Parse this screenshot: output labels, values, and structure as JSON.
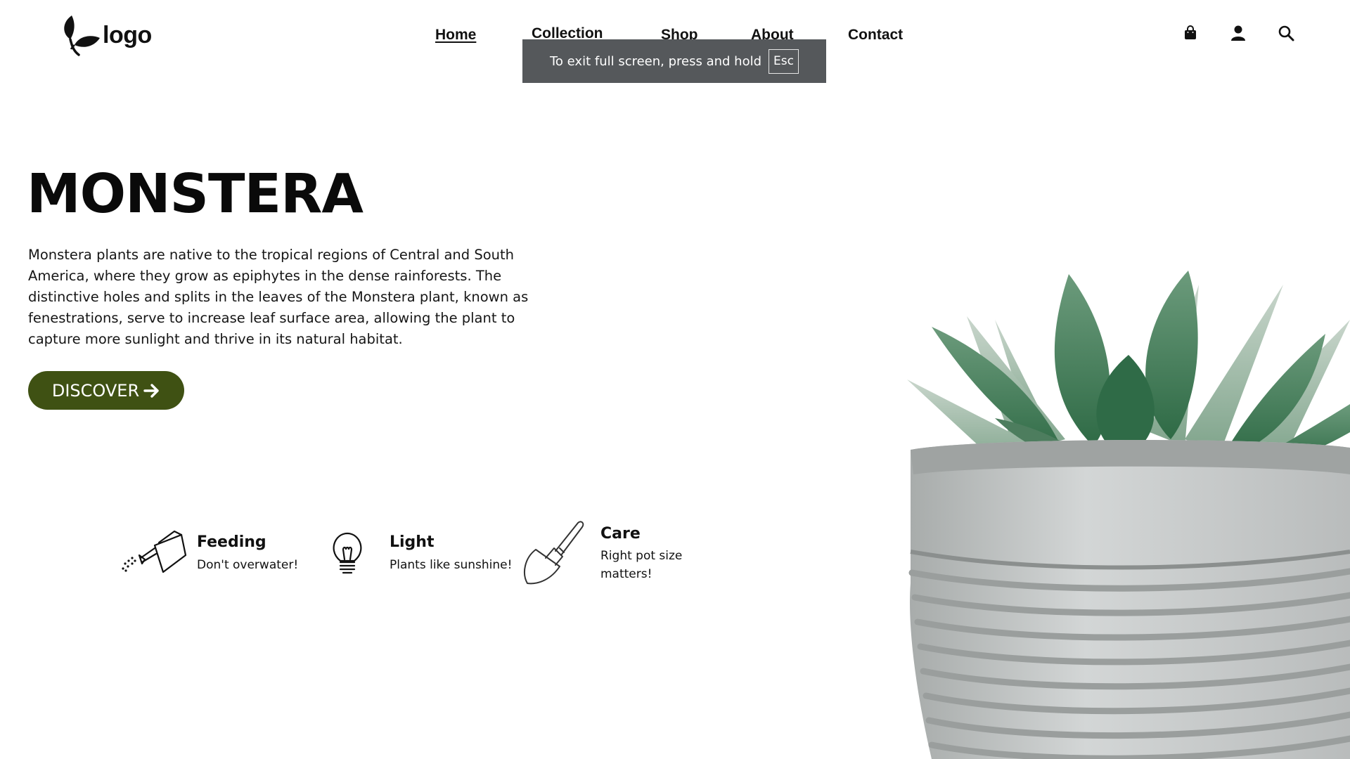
{
  "header": {
    "logo_text": "logo",
    "nav": [
      {
        "label": "Home",
        "active": true
      },
      {
        "label": "Collection",
        "active": false
      },
      {
        "label": "Shop",
        "active": false
      },
      {
        "label": "About",
        "active": false
      },
      {
        "label": "Contact",
        "active": false
      }
    ],
    "icons": [
      "shopping-bag-icon",
      "user-icon",
      "search-icon"
    ]
  },
  "fullscreen_notice": {
    "text": "To exit full screen, press and hold",
    "key": "Esc"
  },
  "hero": {
    "title": "MONSTERA",
    "description": "Monstera plants are native to the tropical regions of Central and South America, where they grow as epiphytes in the dense rainforests. The distinctive holes and splits in the leaves of the Monstera plant, known as fenestrations, serve to increase leaf surface area, allowing the plant to capture more sunlight and thrive in its natural habitat.",
    "button_label": "DISCOVER"
  },
  "features": [
    {
      "title": "Feeding",
      "desc": "Don't overwater!",
      "icon": "watering-can-icon"
    },
    {
      "title": "Light",
      "desc": "Plants like sunshine!",
      "icon": "light-bulb-icon"
    },
    {
      "title": "Care",
      "desc": "Right pot size matters!",
      "icon": "trowel-icon"
    }
  ],
  "colors": {
    "accent": "#3f5113",
    "toast_bg": "#55585b",
    "text": "#111111"
  }
}
